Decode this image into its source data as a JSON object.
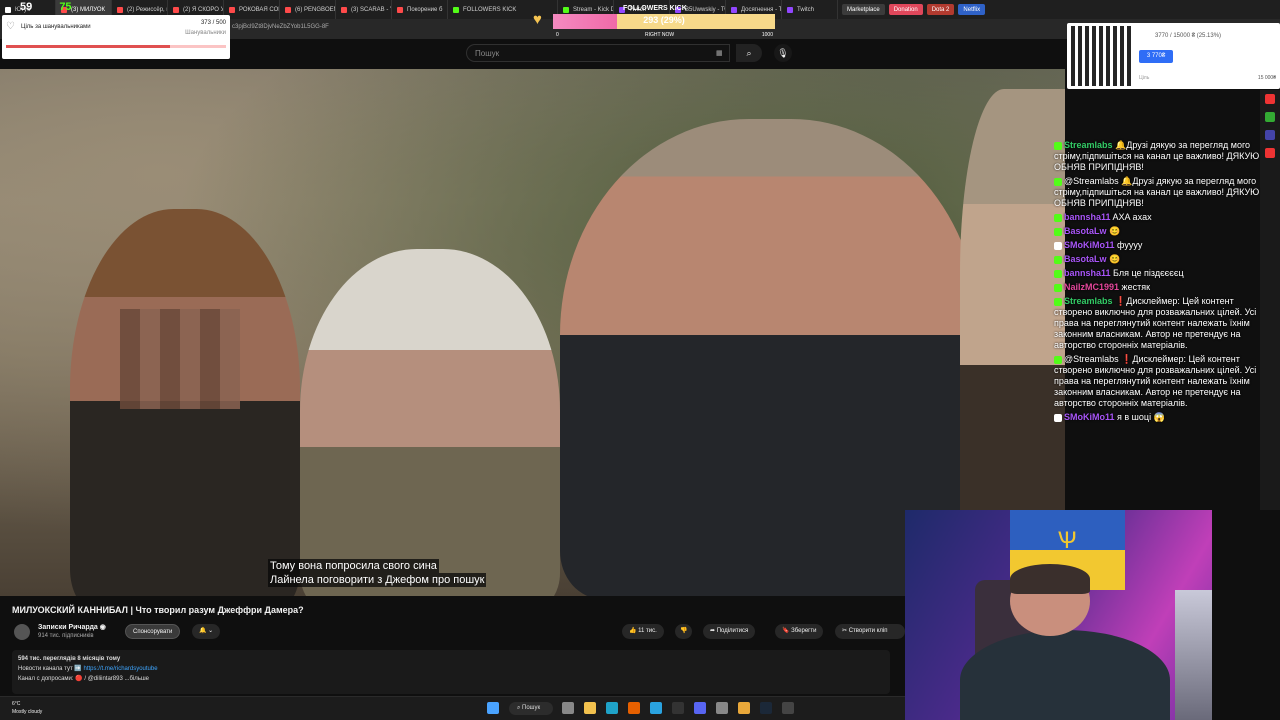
{
  "browser": {
    "tabs": [
      {
        "label": "Ютуб",
        "color": "#ffffff"
      },
      {
        "label": "(3) МИЛУОК",
        "color": "#ff4a4a"
      },
      {
        "label": "(2) Режиссёр, к",
        "color": "#ff4a4a"
      },
      {
        "label": "(2) Я СКОРО УМ",
        "color": "#ff4a4a"
      },
      {
        "label": "РОКОВАЯ СОБА",
        "color": "#ff4a4a"
      },
      {
        "label": "(6) PENGBOEN",
        "color": "#ff4a4a"
      },
      {
        "label": "(3) SCARAB - Yo",
        "color": "#ff4a4a"
      },
      {
        "label": "Покорение б",
        "color": "#ff4a4a"
      },
      {
        "label": "FOLLOWERS KICK",
        "color": "#53fc18"
      },
      {
        "label": "Stream - Kick D",
        "color": "#53fc18"
      },
      {
        "label": "Twitch",
        "color": "#9146ff"
      },
      {
        "label": "B5Uwwskiy - Tw",
        "color": "#9146ff"
      },
      {
        "label": "Досягнення - Tw",
        "color": "#9146ff"
      },
      {
        "label": "Twitch",
        "color": "#9146ff"
      }
    ],
    "pills": [
      {
        "label": "Marketplace",
        "bg": "#3b3b3b"
      },
      {
        "label": "Donation",
        "bg": "#e0475b"
      },
      {
        "label": "Dota 2",
        "bg": "#b23a2f"
      },
      {
        "label": "Netflix",
        "bg": "#2f62c8"
      }
    ],
    "url_fragment": "c3pjBcl9Zt8DjvNeZbZYob1L5GG-8F"
  },
  "youtube": {
    "search_placeholder": "Пошук",
    "video_title": "МИЛУОКСКИЙ КАННИБАЛ | Что творил разум Джеффри Дамера?",
    "channel": "Записки Ричарда",
    "subscribers": "914 тис. підписників",
    "sponsor_label": "Спонсорувати",
    "likes": "11 тис.",
    "share_label": "Поділитися",
    "save_label": "Зберегти",
    "clip_label": "Створити кліп",
    "description": {
      "line1": "594 тис. переглядів  8 місяців тому",
      "line2_text": "Новости канала тут ➡️ ",
      "line2_link": "https://t.me/richardsyoutube",
      "line3": "Канал с допросами: 🔴 / @diliintar893 ...більше"
    }
  },
  "subtitles": [
    "Тому вона попросила свого сина",
    "Лайнела поговорити з Джефом про пошук"
  ],
  "overlays": {
    "top_number": "59",
    "top_number2": "75",
    "goal": {
      "label": "Ціль за шанувальниками",
      "count": "373 / 500",
      "sublabel": "Шанувальники",
      "progress": 0.746
    },
    "followers": {
      "title": "FOLLOWERS KICK",
      "value": "293 (29%)",
      "progress": 0.29,
      "min": "0",
      "mid": "RIGHT NOW",
      "max": "1000"
    },
    "donation": {
      "value": "3770 / 15000 ₴ (25.13%)",
      "button": "3 770₴",
      "current": "Ціль",
      "max": "15 000₴"
    }
  },
  "chat": [
    {
      "user": "Streamlabs",
      "cls": "u-stream",
      "text": "🔔Друзі дякую за перегляд мого стріму,підпишіться на канал це важливо! ДЯКУЮ ОБНЯВ ПРИПІДНЯВ!",
      "badge": "#53fc18"
    },
    {
      "user": "@Streamlabs",
      "cls": "",
      "text": "🔔Друзі дякую за перегляд мого стріму,підпишіться на канал це важливо! ДЯКУЮ ОБНЯВ ПРИПІДНЯВ!",
      "badge": "#53fc18"
    },
    {
      "user": "bannsha11",
      "cls": "u-purple",
      "text": "AXA axax",
      "badge": "#53fc18"
    },
    {
      "user": "BasotaLw",
      "cls": "u-purple",
      "text": "😊",
      "badge": "#53fc18"
    },
    {
      "user": "SMoKiMo11",
      "cls": "u-purple",
      "text": "фуууу",
      "badge": "#ffffff"
    },
    {
      "user": "BasotaLw",
      "cls": "u-purple",
      "text": "😊",
      "badge": "#53fc18"
    },
    {
      "user": "bannsha11",
      "cls": "u-purple",
      "text": "Бля це пiздєєєєц",
      "badge": "#53fc18"
    },
    {
      "user": "NailzMC1991",
      "cls": "u-pink",
      "text": "жестяк",
      "badge": "#53fc18"
    },
    {
      "user": "Streamlabs",
      "cls": "u-stream",
      "text": "❗Дисклеймер: Цей контент створено виключно для розважальних цілей. Усі права на переглянутий контент належать їхнім законним власникам. Автор не претендує на авторство сторонніх матеріалів.",
      "badge": "#53fc18"
    },
    {
      "user": "@Streamlabs",
      "cls": "",
      "text": "❗Дисклеймер: Цей контент створено виключно для розважальних цілей. Усі права на переглянутий контент належать їхнім законним власникам. Автор не претендує на авторство сторонніх матеріалів.",
      "badge": "#53fc18"
    },
    {
      "user": "SMoKiMo11",
      "cls": "u-purple",
      "text": "я в шоці 😱",
      "badge": "#ffffff"
    }
  ],
  "taskbar": {
    "weather_temp": "6°C",
    "weather_desc": "Mostly cloudy",
    "search_label": "Пошук"
  },
  "colors": {
    "accent_like": "#f1f1f1",
    "kick_green": "#53fc18"
  }
}
